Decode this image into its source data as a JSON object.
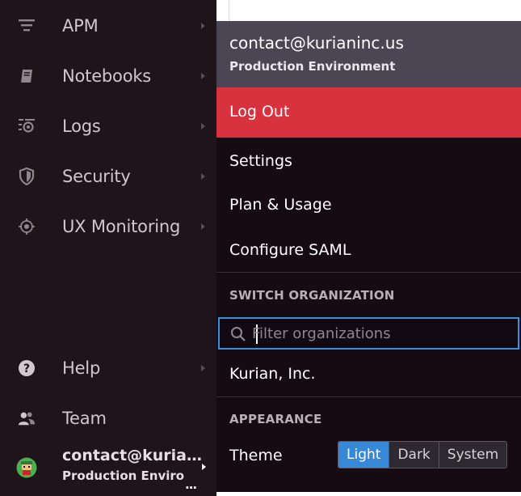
{
  "sidebar": {
    "items": [
      {
        "label": "APM",
        "icon": "apm-icon"
      },
      {
        "label": "Notebooks",
        "icon": "notebook-icon"
      },
      {
        "label": "Logs",
        "icon": "logs-icon"
      },
      {
        "label": "Security",
        "icon": "shield-icon"
      },
      {
        "label": "UX Monitoring",
        "icon": "ux-monitoring-icon"
      },
      {
        "label": "Help",
        "icon": "help-icon"
      },
      {
        "label": "Team",
        "icon": "team-icon"
      }
    ],
    "user": {
      "email": "contact@kuria…",
      "environment": "Production Enviro",
      "more": "..."
    }
  },
  "menu": {
    "header": {
      "email": "contact@kurianinc.us",
      "environment": "Production Environment"
    },
    "logout": "Log Out",
    "links": [
      "Settings",
      "Plan & Usage",
      "Configure SAML"
    ],
    "switch_org": {
      "title": "SWITCH ORGANIZATION",
      "filter_placeholder": "Filter organizations",
      "organizations": [
        "Kurian, Inc."
      ]
    },
    "appearance": {
      "title": "APPEARANCE",
      "theme_label": "Theme",
      "options": [
        "Light",
        "Dark",
        "System"
      ],
      "selected": "Light"
    }
  },
  "colors": {
    "sidebar_bg": "#1e1419",
    "menu_bg": "#170b13",
    "menu_header_bg": "#4b4554",
    "logout_bg": "#d9323f",
    "accent": "#3788d6"
  }
}
